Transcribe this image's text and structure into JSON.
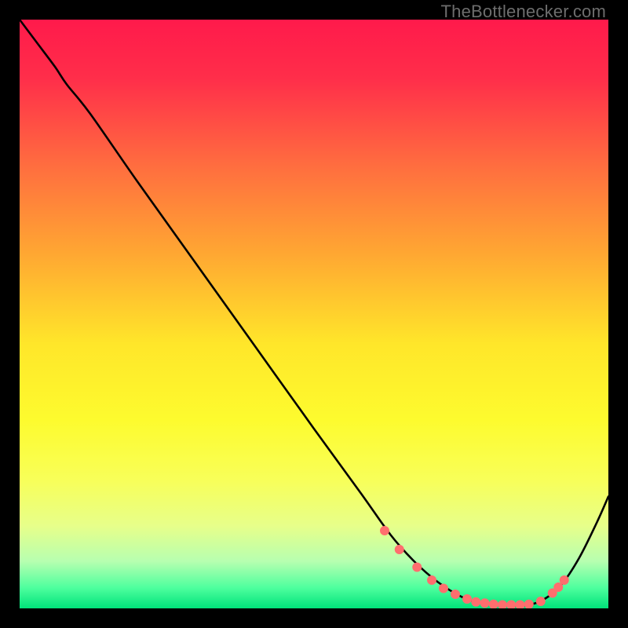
{
  "watermark": "TheBottlenecker.com",
  "chart_data": {
    "type": "line",
    "title": "",
    "xlabel": "",
    "ylabel": "",
    "xlim": [
      0,
      100
    ],
    "ylim": [
      0,
      100
    ],
    "gradient_stops": [
      {
        "offset": 0.0,
        "color": "#ff1a4b"
      },
      {
        "offset": 0.1,
        "color": "#ff2e4a"
      },
      {
        "offset": 0.25,
        "color": "#ff6e3f"
      },
      {
        "offset": 0.4,
        "color": "#ffa832"
      },
      {
        "offset": 0.55,
        "color": "#ffe62a"
      },
      {
        "offset": 0.68,
        "color": "#fdfb2e"
      },
      {
        "offset": 0.78,
        "color": "#f8ff58"
      },
      {
        "offset": 0.86,
        "color": "#e7ff8a"
      },
      {
        "offset": 0.92,
        "color": "#b7ffb0"
      },
      {
        "offset": 0.965,
        "color": "#4eff9e"
      },
      {
        "offset": 1.0,
        "color": "#00e27a"
      }
    ],
    "series": [
      {
        "name": "curve",
        "x": [
          0.0,
          3.0,
          6.0,
          8.0,
          12.0,
          20.0,
          30.0,
          40.0,
          50.0,
          58.0,
          63.0,
          67.0,
          71.0,
          75.0,
          78.0,
          82.0,
          86.0,
          89.0,
          92.0,
          95.0,
          98.0,
          100.0
        ],
        "y": [
          100.0,
          96.0,
          92.0,
          89.0,
          84.0,
          72.5,
          58.5,
          44.5,
          30.5,
          19.5,
          12.5,
          8.0,
          4.5,
          2.0,
          1.0,
          0.5,
          0.5,
          1.5,
          4.0,
          8.5,
          14.5,
          19.0
        ]
      }
    ],
    "markers": {
      "name": "dots",
      "color": "#ff6e6e",
      "radius": 6,
      "x": [
        62.0,
        64.5,
        67.5,
        70.0,
        72.0,
        74.0,
        76.0,
        77.5,
        79.0,
        80.5,
        82.0,
        83.5,
        85.0,
        86.5,
        88.5,
        90.5,
        91.5,
        92.5
      ],
      "y": [
        13.2,
        10.0,
        7.0,
        4.8,
        3.4,
        2.4,
        1.6,
        1.1,
        0.9,
        0.7,
        0.6,
        0.6,
        0.6,
        0.7,
        1.2,
        2.6,
        3.6,
        4.8
      ]
    }
  }
}
